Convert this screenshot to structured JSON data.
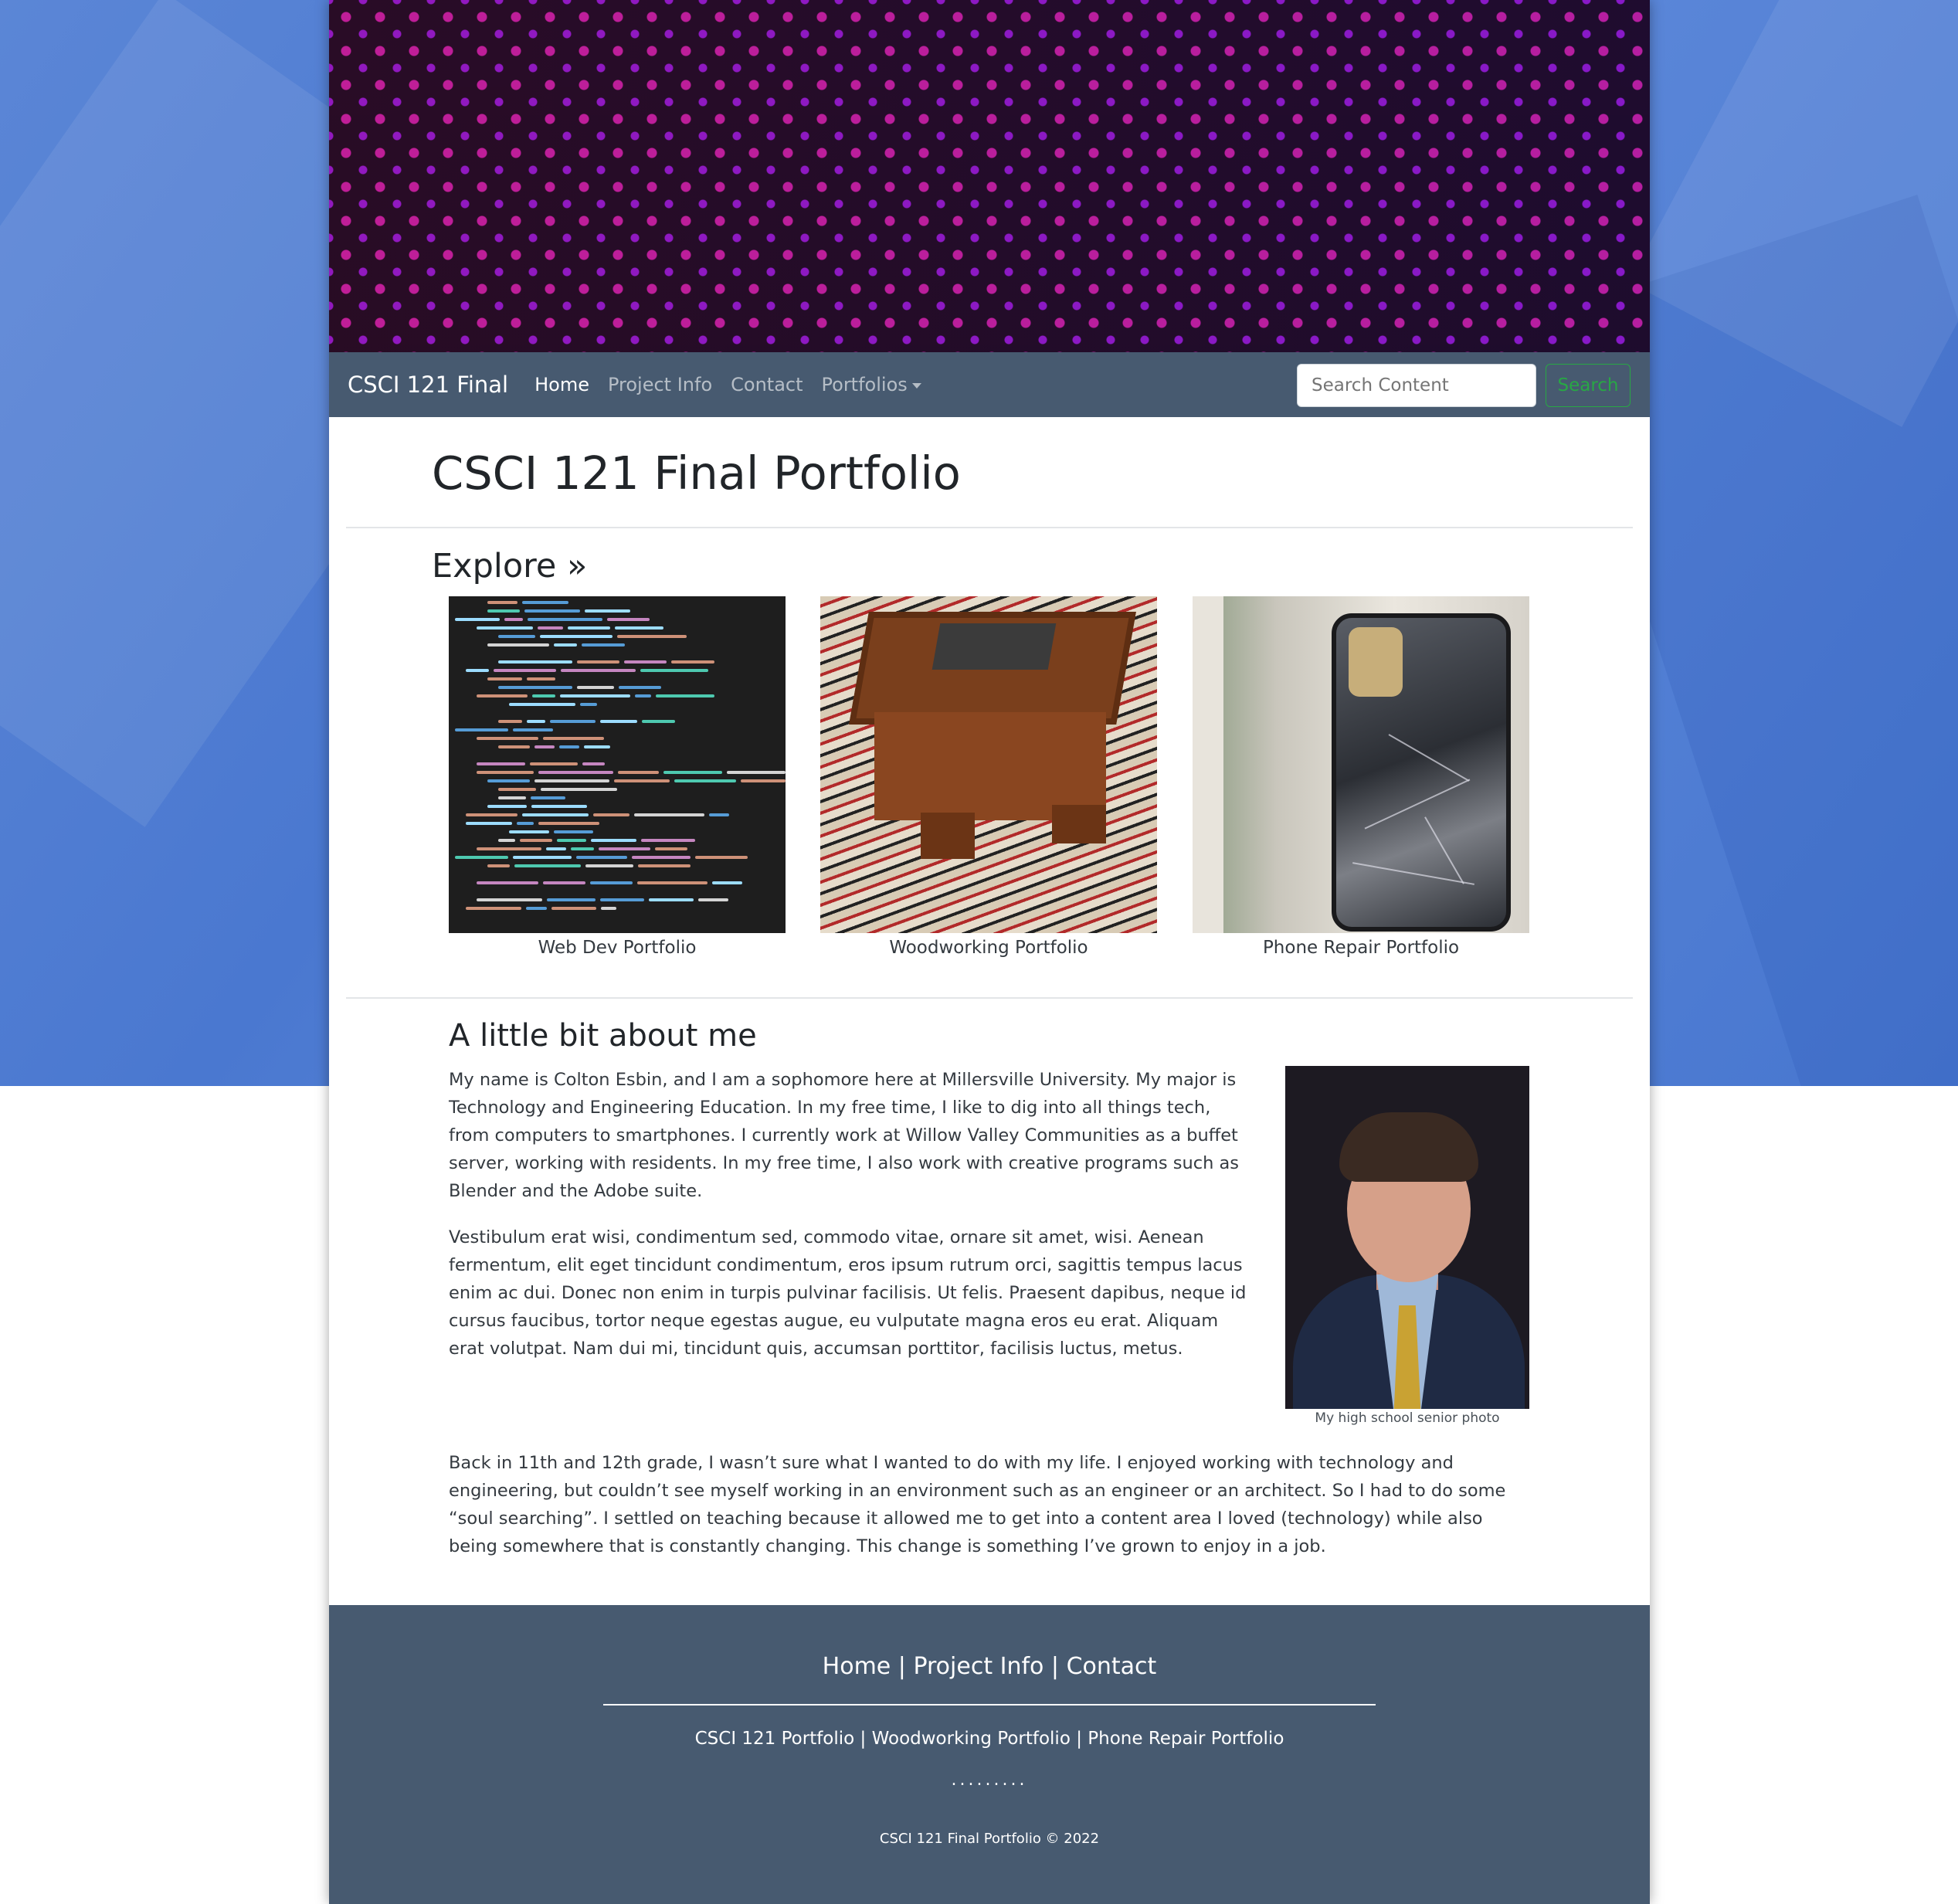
{
  "navbar": {
    "brand": "CSCI 121 Final",
    "links": [
      "Home",
      "Project Info",
      "Contact",
      "Portfolios"
    ],
    "search_placeholder": "Search Content",
    "search_button": "Search"
  },
  "main": {
    "title": "CSCI 121 Final Portfolio",
    "explore_heading": "Explore »",
    "cards": [
      {
        "caption": "Web Dev Portfolio",
        "image_icon": "code-screenshot-image"
      },
      {
        "caption": "Woodworking Portfolio",
        "image_icon": "wooden-box-image"
      },
      {
        "caption": "Phone Repair Portfolio",
        "image_icon": "cracked-phone-image"
      }
    ]
  },
  "about": {
    "heading": "A little bit about me",
    "paragraphs": [
      "My name is Colton Esbin, and I am a sophomore here at Millersville University. My major is Technology and Engineering Education. In my free time, I like to dig into all things tech, from computers to smartphones. I currently work at Willow Valley Communities as a buffet server, working with residents. In my free time, I also work with creative programs such as Blender and the Adobe suite.",
      "Vestibulum erat wisi, condimentum sed, commodo vitae, ornare sit amet, wisi. Aenean fermentum, elit eget tincidunt condimentum, eros ipsum rutrum orci, sagittis tempus lacus enim ac dui. Donec non enim in turpis pulvinar facilisis. Ut felis. Praesent dapibus, neque id cursus faucibus, tortor neque egestas augue, eu vulputate magna eros eu erat. Aliquam erat volutpat. Nam dui mi, tincidunt quis, accumsan porttitor, facilisis luctus, metus.",
      "Back in 11th and 12th grade, I wasn’t sure what I wanted to do with my life. I enjoyed working with technology and engineering, but couldn’t see myself working in an environment such as an engineer or an architect. So I had to do some “soul searching”. I settled on teaching because it allowed me to get into a content area I loved (technology) while also being somewhere that is constantly changing. This change is something I’ve grown to enjoy in a job."
    ],
    "photo_caption": "My high school senior photo"
  },
  "footer": {
    "primary_links": "Home | Project Info | Contact",
    "secondary_links": "CSCI 121 Portfolio | Woodworking Portfolio | Phone Repair Portfolio",
    "dots": ".........",
    "copyright": "CSCI 121 Final Portfolio © 2022"
  },
  "colors": {
    "navbar_bg": "#475a70",
    "page_bg_blue": "#4a78d0",
    "search_accent": "#28a745"
  }
}
